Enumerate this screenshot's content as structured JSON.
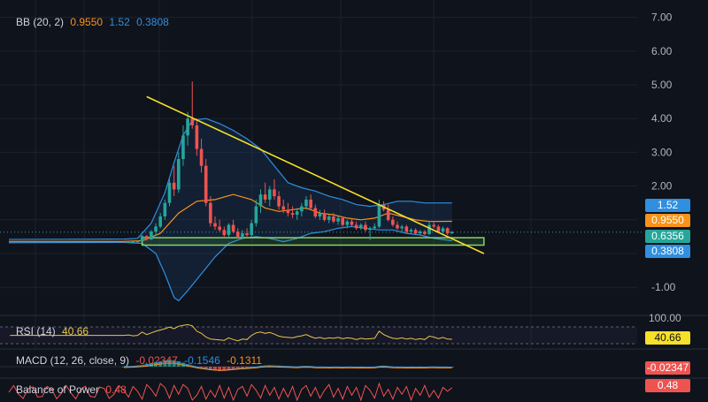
{
  "colors": {
    "background": "#0f131c",
    "grid": "#1c2230",
    "bull": "#26a69a",
    "bear": "#ef5350",
    "bb_basis": "#f7931a",
    "bb_band": "#2f8fe0",
    "trendline": "#f5e02a",
    "support_zone": "#4caf50",
    "rsi_line": "#e6c84a",
    "bop_line": "#ef5350"
  },
  "indicators": {
    "bb": {
      "name": "BB (20, 2)",
      "basis": "0.9550",
      "upper": "1.52",
      "lower": "0.3808"
    },
    "rsi": {
      "name": "RSI (14)",
      "value": "40.66"
    },
    "macd": {
      "name": "MACD (12, 26, close, 9)",
      "v1": "-0.02347",
      "v2": "-0.1546",
      "v3": "-0.1311"
    },
    "bop": {
      "name": "Balance of Power",
      "value": "0.48"
    }
  },
  "price_axis": {
    "ticks": [
      "7.00",
      "6.00",
      "5.00",
      "4.00",
      "3.00",
      "2.00",
      "0",
      "-1.00"
    ],
    "rsi_top": "100.00"
  },
  "badges": {
    "upper": "1.52",
    "basis": "0.9550",
    "last": "0.6356",
    "lower": "0.3808",
    "rsi": "40.66",
    "macd": "-0.02347",
    "bop": "0.48"
  },
  "chart_data": {
    "type": "candlestick",
    "ylim": [
      -1.5,
      7.2
    ],
    "x_range": [
      0,
      76
    ],
    "candles": [
      [
        0.35,
        0.36,
        0.33,
        0.34
      ],
      [
        0.34,
        0.35,
        0.33,
        0.34
      ],
      [
        0.34,
        0.36,
        0.33,
        0.35
      ],
      [
        0.35,
        0.38,
        0.34,
        0.36
      ],
      [
        0.36,
        0.55,
        0.35,
        0.52
      ],
      [
        0.52,
        0.55,
        0.38,
        0.42
      ],
      [
        0.42,
        0.7,
        0.4,
        0.65
      ],
      [
        0.65,
        0.9,
        0.55,
        0.8
      ],
      [
        0.8,
        1.2,
        0.75,
        1.1
      ],
      [
        1.1,
        1.6,
        1.0,
        1.5
      ],
      [
        1.5,
        2.2,
        1.4,
        2.1
      ],
      [
        2.1,
        2.6,
        1.7,
        1.9
      ],
      [
        1.9,
        3.0,
        1.8,
        2.8
      ],
      [
        2.8,
        3.8,
        2.6,
        3.5
      ],
      [
        3.5,
        4.2,
        3.2,
        4.0
      ],
      [
        4.0,
        5.1,
        3.7,
        3.8
      ],
      [
        3.8,
        4.0,
        2.9,
        3.1
      ],
      [
        3.1,
        3.4,
        2.4,
        2.6
      ],
      [
        2.6,
        2.8,
        1.4,
        1.5
      ],
      [
        1.5,
        1.7,
        0.8,
        0.9
      ],
      [
        0.9,
        1.1,
        0.7,
        0.8
      ],
      [
        0.8,
        1.0,
        0.65,
        0.7
      ],
      [
        0.7,
        0.8,
        0.5,
        0.55
      ],
      [
        0.55,
        0.9,
        0.5,
        0.85
      ],
      [
        0.85,
        1.0,
        0.6,
        0.65
      ],
      [
        0.65,
        0.75,
        0.45,
        0.5
      ],
      [
        0.5,
        0.7,
        0.45,
        0.6
      ],
      [
        0.6,
        0.75,
        0.5,
        0.55
      ],
      [
        0.55,
        1.0,
        0.5,
        0.9
      ],
      [
        0.9,
        1.6,
        0.8,
        1.4
      ],
      [
        1.4,
        1.9,
        1.2,
        1.75
      ],
      [
        1.75,
        2.1,
        1.5,
        1.6
      ],
      [
        1.6,
        2.0,
        1.4,
        1.9
      ],
      [
        1.9,
        2.2,
        1.6,
        1.7
      ],
      [
        1.7,
        1.85,
        1.3,
        1.4
      ],
      [
        1.4,
        1.6,
        1.2,
        1.3
      ],
      [
        1.3,
        1.5,
        1.1,
        1.2
      ],
      [
        1.2,
        1.4,
        1.05,
        1.15
      ],
      [
        1.15,
        1.35,
        1.0,
        1.25
      ],
      [
        1.25,
        1.5,
        1.1,
        1.4
      ],
      [
        1.4,
        1.7,
        1.3,
        1.6
      ],
      [
        1.6,
        1.75,
        1.3,
        1.35
      ],
      [
        1.35,
        1.45,
        1.05,
        1.1
      ],
      [
        1.1,
        1.3,
        1.0,
        1.2
      ],
      [
        1.2,
        1.3,
        0.95,
        1.0
      ],
      [
        1.0,
        1.15,
        0.9,
        1.1
      ],
      [
        1.1,
        1.2,
        0.9,
        0.95
      ],
      [
        0.95,
        1.1,
        0.85,
        1.05
      ],
      [
        1.05,
        1.1,
        0.8,
        0.85
      ],
      [
        0.85,
        1.0,
        0.75,
        0.95
      ],
      [
        0.95,
        1.05,
        0.8,
        0.85
      ],
      [
        0.85,
        0.95,
        0.7,
        0.75
      ],
      [
        0.75,
        0.9,
        0.7,
        0.85
      ],
      [
        0.85,
        0.95,
        0.65,
        0.7
      ],
      [
        0.7,
        0.8,
        0.4,
        0.75
      ],
      [
        0.75,
        0.9,
        0.7,
        0.8
      ],
      [
        0.8,
        1.6,
        0.75,
        1.45
      ],
      [
        1.45,
        1.55,
        1.25,
        1.3
      ],
      [
        1.3,
        1.45,
        0.95,
        1.0
      ],
      [
        1.0,
        1.1,
        0.8,
        0.85
      ],
      [
        0.85,
        0.95,
        0.7,
        0.75
      ],
      [
        0.75,
        0.85,
        0.65,
        0.8
      ],
      [
        0.8,
        0.85,
        0.6,
        0.65
      ],
      [
        0.65,
        0.75,
        0.58,
        0.7
      ],
      [
        0.7,
        0.75,
        0.55,
        0.6
      ],
      [
        0.6,
        0.7,
        0.55,
        0.65
      ],
      [
        0.65,
        0.7,
        0.55,
        0.58
      ],
      [
        0.58,
        0.95,
        0.55,
        0.85
      ],
      [
        0.85,
        0.95,
        0.75,
        0.8
      ],
      [
        0.8,
        0.85,
        0.62,
        0.65
      ],
      [
        0.65,
        0.8,
        0.6,
        0.75
      ],
      [
        0.75,
        0.78,
        0.55,
        0.6
      ],
      [
        0.6,
        0.66,
        0.58,
        0.64
      ]
    ],
    "bb_upper": [
      [
        0,
        0.43
      ],
      [
        3,
        0.45
      ],
      [
        6,
        0.9
      ],
      [
        9,
        1.8
      ],
      [
        11,
        2.7
      ],
      [
        13,
        3.5
      ],
      [
        15,
        3.95
      ],
      [
        18,
        4.0
      ],
      [
        21,
        3.85
      ],
      [
        24,
        3.65
      ],
      [
        27,
        3.4
      ],
      [
        30,
        3.1
      ],
      [
        33,
        2.6
      ],
      [
        36,
        2.1
      ],
      [
        39,
        1.95
      ],
      [
        42,
        1.85
      ],
      [
        45,
        1.7
      ],
      [
        48,
        1.6
      ],
      [
        51,
        1.45
      ],
      [
        54,
        1.4
      ],
      [
        57,
        1.45
      ],
      [
        60,
        1.55
      ],
      [
        63,
        1.55
      ],
      [
        66,
        1.5
      ],
      [
        69,
        1.5
      ],
      [
        72,
        1.5
      ]
    ],
    "bb_basis": [
      [
        0,
        0.36
      ],
      [
        4,
        0.38
      ],
      [
        8,
        0.6
      ],
      [
        12,
        1.2
      ],
      [
        16,
        1.55
      ],
      [
        20,
        1.6
      ],
      [
        24,
        1.75
      ],
      [
        28,
        1.6
      ],
      [
        31,
        1.35
      ],
      [
        34,
        1.25
      ],
      [
        37,
        1.3
      ],
      [
        40,
        1.35
      ],
      [
        43,
        1.2
      ],
      [
        46,
        1.15
      ],
      [
        49,
        1.05
      ],
      [
        52,
        1.0
      ],
      [
        55,
        1.05
      ],
      [
        58,
        1.2
      ],
      [
        61,
        1.1
      ],
      [
        64,
        1.0
      ],
      [
        67,
        0.95
      ],
      [
        72,
        0.955
      ]
    ],
    "bb_lower": [
      [
        0,
        0.33
      ],
      [
        4,
        0.3
      ],
      [
        7,
        0.0
      ],
      [
        9,
        -0.6
      ],
      [
        11,
        -1.3
      ],
      [
        12,
        -1.4
      ],
      [
        14,
        -1.1
      ],
      [
        17,
        -0.6
      ],
      [
        20,
        -0.1
      ],
      [
        23,
        0.3
      ],
      [
        26,
        0.45
      ],
      [
        29,
        0.5
      ],
      [
        32,
        0.45
      ],
      [
        35,
        0.35
      ],
      [
        38,
        0.45
      ],
      [
        41,
        0.6
      ],
      [
        44,
        0.65
      ],
      [
        47,
        0.75
      ],
      [
        50,
        0.8
      ],
      [
        53,
        0.75
      ],
      [
        56,
        0.7
      ],
      [
        59,
        0.7
      ],
      [
        62,
        0.6
      ],
      [
        65,
        0.55
      ],
      [
        68,
        0.45
      ],
      [
        72,
        0.38
      ]
    ],
    "trendline": [
      [
        5,
        4.65
      ],
      [
        79,
        0.0
      ]
    ],
    "support_zone": {
      "x": [
        4,
        79
      ],
      "y": [
        0.25,
        0.47
      ]
    },
    "rsi": [
      50,
      51,
      49,
      50,
      58,
      52,
      56,
      60,
      63,
      66,
      70,
      66,
      72,
      74,
      76,
      73,
      60,
      55,
      46,
      41,
      40,
      39,
      38,
      44,
      40,
      37,
      41,
      40,
      50,
      56,
      58,
      55,
      57,
      53,
      48,
      46,
      45,
      44,
      47,
      49,
      52,
      47,
      43,
      45,
      42,
      44,
      43,
      45,
      42,
      44,
      43,
      40,
      43,
      41,
      42,
      43,
      60,
      52,
      47,
      43,
      42,
      44,
      41,
      43,
      40,
      42,
      40,
      48,
      46,
      42,
      45,
      41,
      40.66
    ],
    "macd_hist": [
      0,
      0.01,
      0.02,
      0.04,
      0.06,
      0.1,
      0.14,
      0.18,
      0.22,
      0.26,
      0.28,
      0.26,
      0.22,
      0.16,
      0.1,
      0.04,
      -0.02,
      -0.06,
      -0.1,
      -0.14,
      -0.16,
      -0.18,
      -0.17,
      -0.15,
      -0.13,
      -0.1,
      -0.08,
      -0.06,
      -0.04,
      -0.02,
      0.02,
      0.04,
      0.05,
      0.04,
      0.03,
      0.02,
      0.01,
      0,
      -0.01,
      0.01,
      0.02,
      0.01,
      -0.01,
      -0.02,
      -0.02,
      -0.03,
      -0.02,
      -0.02,
      -0.03,
      -0.02,
      -0.02,
      -0.03,
      -0.02,
      -0.03,
      -0.03,
      -0.02,
      0.02,
      0.03,
      0.01,
      -0.01,
      -0.02,
      -0.02,
      -0.03,
      -0.02,
      -0.03,
      -0.02,
      -0.03,
      -0.01,
      -0.01,
      -0.02,
      -0.02,
      -0.02,
      -0.023
    ],
    "bop": [
      0.2,
      -0.5,
      0.6,
      0.1,
      -0.7,
      0.8,
      0.3,
      -0.4,
      0.9,
      0.5,
      -0.6,
      0.7,
      -0.2,
      0.8,
      0.4,
      -0.8,
      -0.3,
      0.6,
      -0.7,
      0.2,
      -0.5,
      0.7,
      -0.6,
      0.5,
      -0.8,
      0.3,
      0.6,
      -0.4,
      0.8,
      0.2,
      -0.6,
      0.7,
      -0.3,
      0.5,
      -0.7,
      0.4,
      -0.5,
      0.6,
      -0.8,
      0.3,
      0.7,
      -0.4,
      0.5,
      -0.6,
      0.2,
      0.8,
      -0.5,
      0.4,
      -0.7,
      0.6,
      -0.3,
      0.5,
      -0.8,
      0.7,
      0.2,
      -0.6,
      0.9,
      -0.4,
      0.3,
      -0.7,
      0.5,
      -0.2,
      0.6,
      -0.8,
      0.4,
      -0.3,
      0.7,
      -0.5,
      0.2,
      -0.6,
      0.5,
      0.1,
      0.48
    ]
  }
}
